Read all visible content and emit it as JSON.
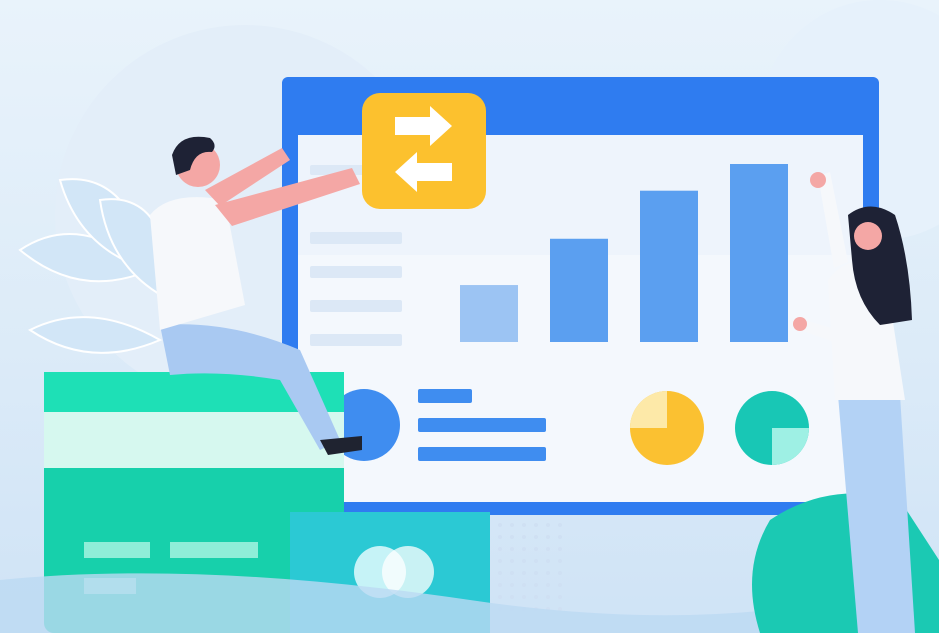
{
  "scene": {
    "type": "flat-illustration",
    "theme_colors": {
      "background": "#dcebf8",
      "monitor_frame": "#2f7cf0",
      "monitor_screen": "#f4f8fd",
      "bar": "#5b9ff0",
      "bar_light": "#9cc4f3",
      "swap_badge": "#fcc12e",
      "card_green": "#1fd5a9",
      "teal": "#18c7b5",
      "yellow": "#fbc131"
    },
    "icons": [
      "swap-arrows-icon",
      "pie-chart-icon",
      "card-chip-icon"
    ],
    "bars_relative_heights": [
      0.32,
      0.58,
      0.85,
      1.0
    ]
  }
}
